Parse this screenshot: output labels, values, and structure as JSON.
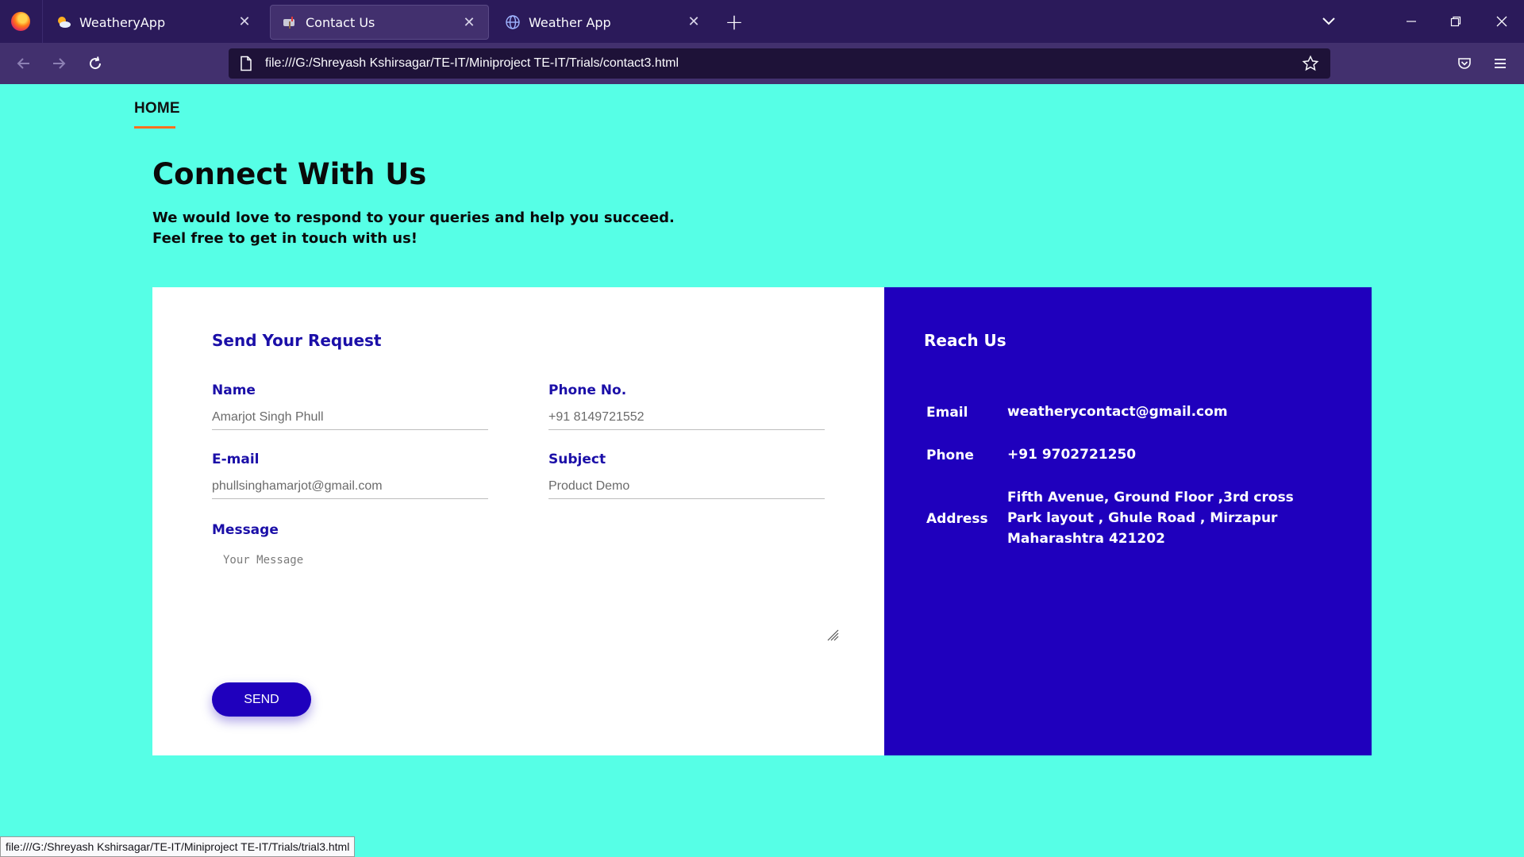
{
  "browser": {
    "tabs": [
      {
        "title": "WeatheryApp",
        "icon": "sun-cloud-icon",
        "active": false
      },
      {
        "title": "Contact Us",
        "icon": "mailbox-icon",
        "active": true
      },
      {
        "title": "Weather App",
        "icon": "globe-icon",
        "active": false
      }
    ],
    "url": "file:///G:/Shreyash Kshirsagar/TE-IT/Miniproject TE-IT/Trials/contact3.html",
    "status_url": "file:///G:/Shreyash Kshirsagar/TE-IT/Miniproject TE-IT/Trials/trial3.html"
  },
  "nav": {
    "home": "HOME"
  },
  "hero": {
    "title": "Connect With Us",
    "line1": "We would love to respond to your queries and help you succeed.",
    "line2": "Feel free to get in touch with us!"
  },
  "form": {
    "title": "Send Your Request",
    "name_label": "Name",
    "name_value": "Amarjot Singh Phull",
    "phone_label": "Phone No.",
    "phone_value": "+91 8149721552",
    "email_label": "E-mail",
    "email_value": "phullsinghamarjot@gmail.com",
    "subject_label": "Subject",
    "subject_value": "Product Demo",
    "message_label": "Message",
    "message_placeholder": "Your Message",
    "send_label": "SEND"
  },
  "reach": {
    "title": "Reach Us",
    "email_label": "Email",
    "email_value": "weatherycontact@gmail.com",
    "phone_label": "Phone",
    "phone_value": "+91 9702721250",
    "address_label": "Address",
    "address_line1": "Fifth Avenue, Ground Floor ,3rd cross",
    "address_line2": "Park layout , Ghule Road , Mirzapur",
    "address_line3": "Maharashtra 421202"
  },
  "colors": {
    "page_bg": "#56ffe6",
    "accent": "#1f00bd",
    "nav_underline": "#ff7020"
  }
}
